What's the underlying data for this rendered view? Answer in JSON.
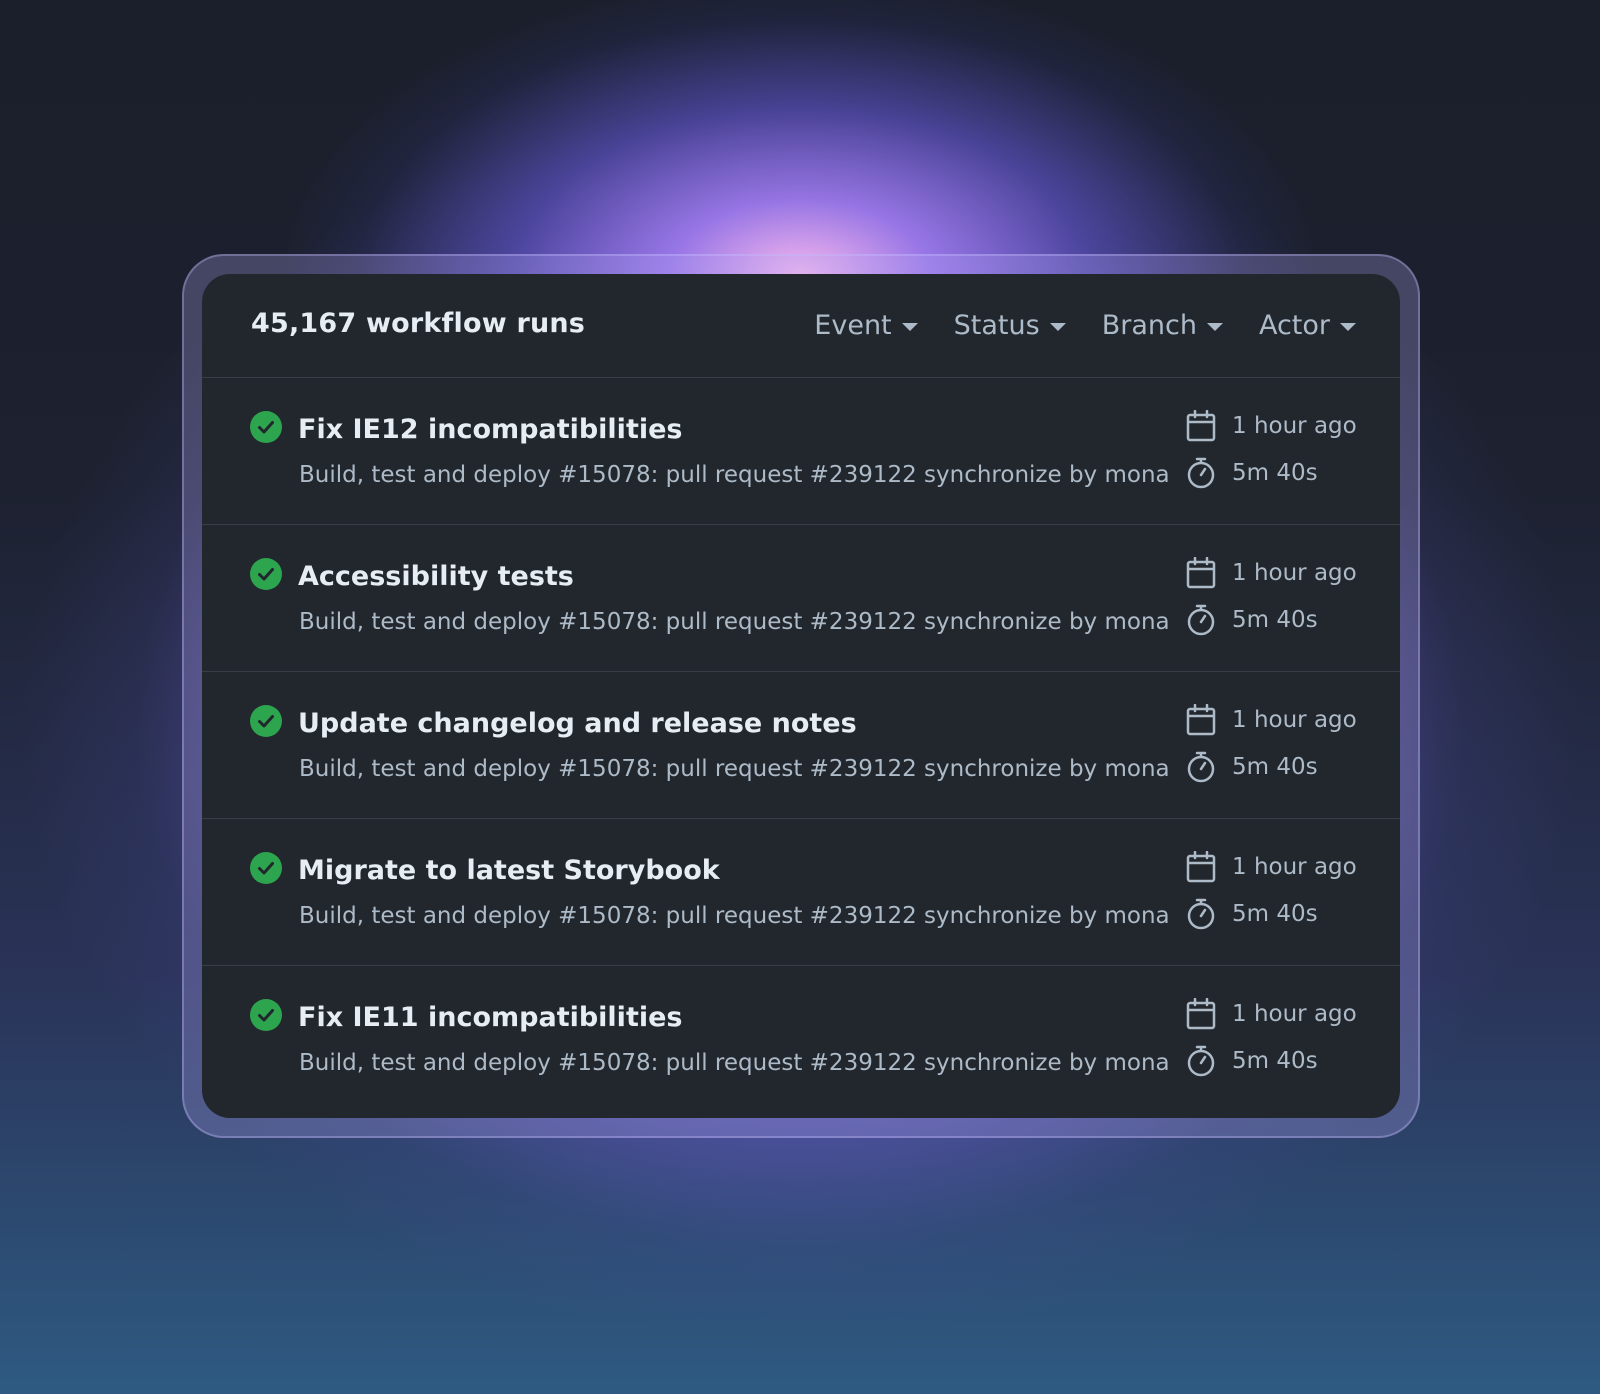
{
  "header": {
    "title": "45,167 workflow runs",
    "filters": [
      {
        "label": "Event"
      },
      {
        "label": "Status"
      },
      {
        "label": "Branch"
      },
      {
        "label": "Actor"
      }
    ]
  },
  "runs": [
    {
      "title": "Fix IE12 incompatibilities",
      "subtitle": "Build, test and deploy #15078: pull request #239122 synchronize by mona",
      "time": "1 hour ago",
      "duration": "5m 40s",
      "status": "success"
    },
    {
      "title": "Accessibility tests",
      "subtitle": "Build, test and deploy #15078: pull request #239122 synchronize by mona",
      "time": "1 hour ago",
      "duration": "5m 40s",
      "status": "success"
    },
    {
      "title": "Update changelog and release notes",
      "subtitle": "Build, test and deploy #15078: pull request #239122 synchronize by mona",
      "time": "1 hour ago",
      "duration": "5m 40s",
      "status": "success"
    },
    {
      "title": "Migrate to latest Storybook",
      "subtitle": "Build, test and deploy #15078: pull request #239122 synchronize by mona",
      "time": "1 hour ago",
      "duration": "5m 40s",
      "status": "success"
    },
    {
      "title": "Fix IE11 incompatibilities",
      "subtitle": "Build, test and deploy #15078: pull request #239122 synchronize by mona",
      "time": "1 hour ago",
      "duration": "5m 40s",
      "status": "success"
    }
  ],
  "icons": {
    "status": "check-circle-icon",
    "time": "calendar-icon",
    "duration": "stopwatch-icon",
    "filter": "triangle-down-icon"
  },
  "colors": {
    "success": "#2da44e",
    "card_bg": "#22272e",
    "muted_text": "#adbac7",
    "primary_text": "#e6edf3"
  }
}
